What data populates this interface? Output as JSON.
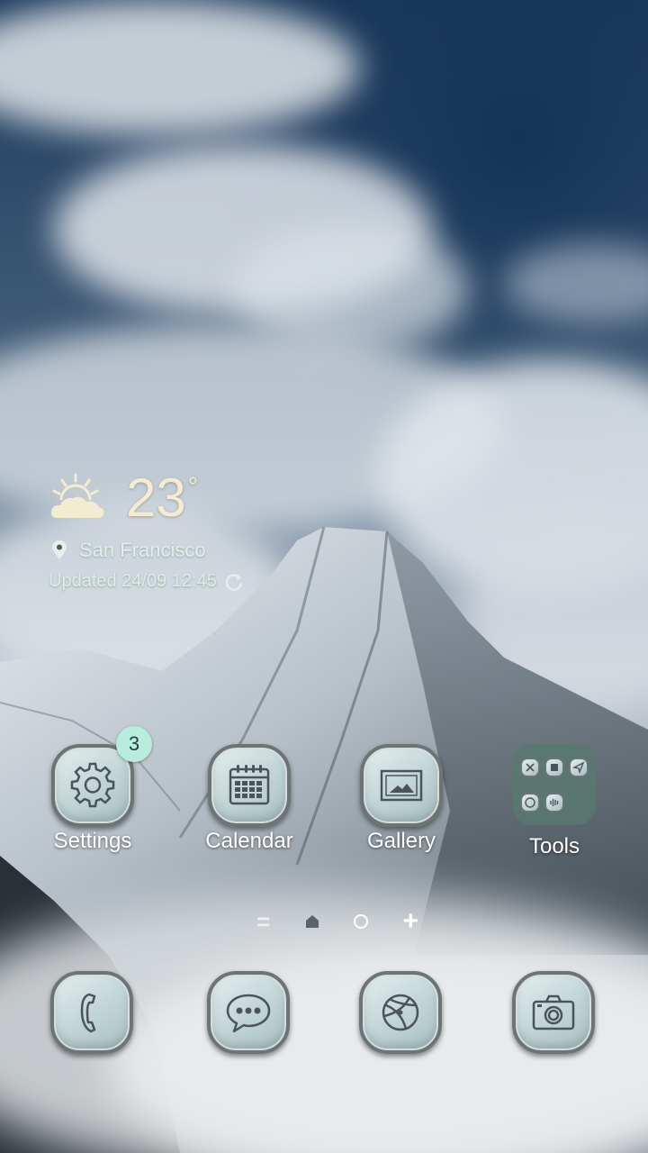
{
  "weather": {
    "temperature": "23",
    "degree_symbol": "°",
    "city": "San Francisco",
    "updated": "Updated 24/09 12:45",
    "icon": "partly-cloudy-icon"
  },
  "apps": [
    {
      "label": "Settings",
      "icon": "gear-icon",
      "badge": "3"
    },
    {
      "label": "Calendar",
      "icon": "calendar-icon"
    },
    {
      "label": "Gallery",
      "icon": "picture-icon"
    },
    {
      "label": "Tools",
      "icon": "folder-icon"
    }
  ],
  "pager": {
    "items": [
      "menu-icon",
      "home-icon",
      "current-page-dot",
      "add-page-icon"
    ],
    "add_symbol": "+",
    "menu_symbol": "="
  },
  "dock": [
    {
      "icon": "phone-icon"
    },
    {
      "icon": "messages-icon"
    },
    {
      "icon": "browser-icon"
    },
    {
      "icon": "camera-icon"
    }
  ],
  "colors": {
    "label": "#ffffff",
    "weather_text": "#dff1e8",
    "temperature": "#f3ecd0",
    "badge": "#b8ecdd",
    "folder": "#58786e"
  }
}
